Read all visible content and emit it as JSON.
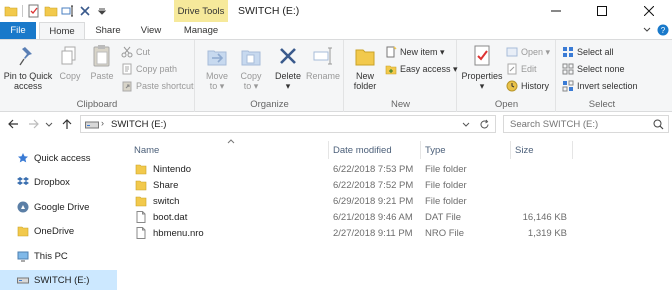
{
  "window": {
    "contextual_tab": "Drive Tools",
    "title": "SWITCH (E:)"
  },
  "tabs": {
    "file": "File",
    "home": "Home",
    "share": "Share",
    "view": "View",
    "manage": "Manage"
  },
  "ribbon": {
    "clipboard": {
      "label": "Clipboard",
      "pin_l1": "Pin to Quick",
      "pin_l2": "access",
      "copy": "Copy",
      "paste": "Paste",
      "cut": "Cut",
      "copy_path": "Copy path",
      "paste_shortcut": "Paste shortcut"
    },
    "organize": {
      "label": "Organize",
      "move_l1": "Move",
      "move_l2": "to ▾",
      "copy_l1": "Copy",
      "copy_l2": "to ▾",
      "delete_l1": "Delete",
      "delete_l2": "▾",
      "rename": "Rename"
    },
    "new": {
      "label": "New",
      "folder_l1": "New",
      "folder_l2": "folder",
      "new_item": "New item ▾",
      "easy_access": "Easy access ▾"
    },
    "open": {
      "label": "Open",
      "properties_l1": "Properties",
      "properties_l2": "▾",
      "open": "Open ▾",
      "edit": "Edit",
      "history": "History"
    },
    "select": {
      "label": "Select",
      "select_all": "Select all",
      "select_none": "Select none",
      "invert": "Invert selection"
    }
  },
  "address": {
    "path": "SWITCH (E:)",
    "search_placeholder": "Search SWITCH (E:)"
  },
  "nav_pane": {
    "items": [
      {
        "label": "Quick access"
      },
      {
        "label": "Dropbox"
      },
      {
        "label": "Google Drive"
      },
      {
        "label": "OneDrive"
      },
      {
        "label": "This PC"
      },
      {
        "label": "SWITCH (E:)"
      }
    ]
  },
  "file_list": {
    "columns": {
      "name": "Name",
      "date": "Date modified",
      "type": "Type",
      "size": "Size"
    },
    "rows": [
      {
        "name": "Nintendo",
        "date": "6/22/2018 7:53 PM",
        "type": "File folder",
        "size": ""
      },
      {
        "name": "Share",
        "date": "6/22/2018 7:52 PM",
        "type": "File folder",
        "size": ""
      },
      {
        "name": "switch",
        "date": "6/29/2018 9:21 PM",
        "type": "File folder",
        "size": ""
      },
      {
        "name": "boot.dat",
        "date": "6/21/2018 9:46 AM",
        "type": "DAT File",
        "size": "16,146 KB"
      },
      {
        "name": "hbmenu.nro",
        "date": "2/27/2018 9:11 PM",
        "type": "NRO File",
        "size": "1,319 KB"
      }
    ]
  },
  "colors": {
    "accent": "#1979ca",
    "contextual_tab": "#f6e99b",
    "folder": "#f2c94c",
    "selected_nav": "#cce8ff"
  }
}
